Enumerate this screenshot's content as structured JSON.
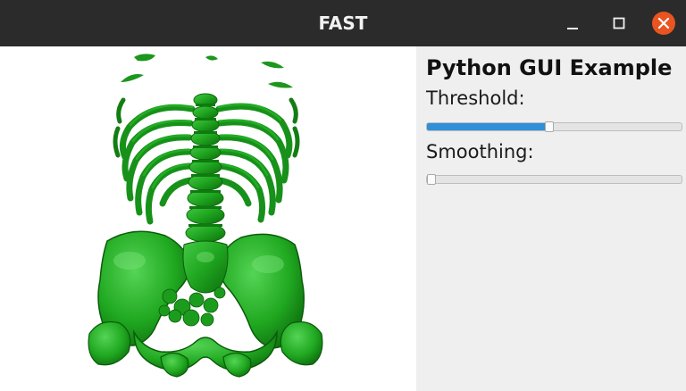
{
  "window": {
    "title": "FAST",
    "controls": {
      "minimize_icon": "minimize-icon",
      "maximize_icon": "maximize-icon",
      "close_icon": "close-icon"
    },
    "titlebar_color": "#2b2b2b",
    "close_button_color": "#e95420"
  },
  "viewport": {
    "content": "3D skeleton render (spine, ribs, pelvis)",
    "render_color": "#1fa51f",
    "background": "#ffffff"
  },
  "panel": {
    "heading": "Python GUI Example",
    "threshold": {
      "label": "Threshold:",
      "value_fraction": 0.48,
      "fill_color": "#2f8fd8"
    },
    "smoothing": {
      "label": "Smoothing:",
      "value_fraction": 0.0
    },
    "background": "#efefef"
  }
}
